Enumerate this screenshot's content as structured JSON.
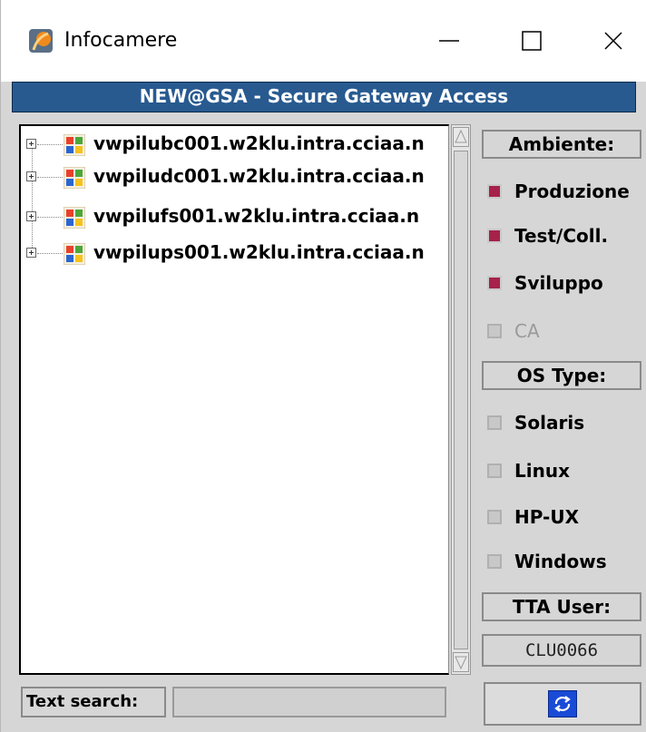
{
  "window": {
    "title": "Infocamere"
  },
  "banner": {
    "text": "NEW@GSA  -  Secure Gateway Access"
  },
  "tree": {
    "items": [
      {
        "label": "vwpilubc001.w2klu.intra.cciaa.n"
      },
      {
        "label": "vwpiludc001.w2klu.intra.cciaa.n"
      },
      {
        "label": "vwpilufs001.w2klu.intra.cciaa.n"
      },
      {
        "label": "vwpilups001.w2klu.intra.cciaa.n"
      }
    ]
  },
  "ambiente": {
    "label": "Ambiente:",
    "options": [
      {
        "label": "Produzione",
        "checked": true,
        "enabled": true
      },
      {
        "label": "Test/Coll.",
        "checked": true,
        "enabled": true
      },
      {
        "label": "Sviluppo",
        "checked": true,
        "enabled": true
      },
      {
        "label": "CA",
        "checked": false,
        "enabled": false
      }
    ]
  },
  "os_type": {
    "label": "OS Type:",
    "options": [
      {
        "label": "Solaris",
        "checked": false
      },
      {
        "label": "Linux",
        "checked": false
      },
      {
        "label": "HP-UX",
        "checked": false
      },
      {
        "label": "Windows",
        "checked": false
      }
    ]
  },
  "tta_user": {
    "label": "TTA User:",
    "value": "CLU0066"
  },
  "search": {
    "label": "Text search:",
    "value": ""
  },
  "colors": {
    "banner": "#285a90",
    "checked": "#a6224a",
    "refresh": "#1a4bd6"
  },
  "icons": {
    "app": "infocamere-logo-icon",
    "host": "windows-icon",
    "refresh": "refresh-icon"
  }
}
